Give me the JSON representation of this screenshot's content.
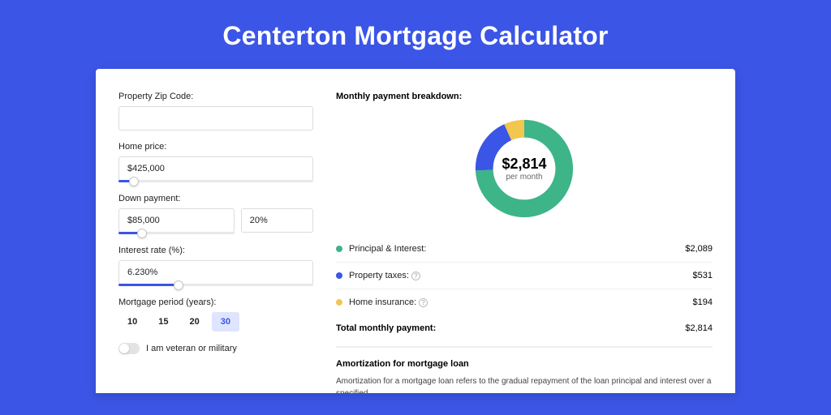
{
  "title": "Centerton Mortgage Calculator",
  "form": {
    "zip_label": "Property Zip Code:",
    "zip_value": "",
    "home_price_label": "Home price:",
    "home_price_value": "$425,000",
    "home_price_slider_pct": 8,
    "down_label": "Down payment:",
    "down_amount_value": "$85,000",
    "down_percent_value": "20%",
    "down_slider_pct": 20,
    "rate_label": "Interest rate (%):",
    "rate_value": "6.230%",
    "rate_slider_pct": 31,
    "period_label": "Mortgage period (years):",
    "periods": [
      "10",
      "15",
      "20",
      "30"
    ],
    "period_active_index": 3,
    "veteran_label": "I am veteran or military",
    "veteran_on": false
  },
  "breakdown": {
    "heading": "Monthly payment breakdown:",
    "donut_amount": "$2,814",
    "donut_sub": "per month",
    "items": [
      {
        "label": "Principal & Interest:",
        "value": "$2,089",
        "color": "#3eb489",
        "info": false
      },
      {
        "label": "Property taxes:",
        "value": "$531",
        "color": "#3b55e6",
        "info": true
      },
      {
        "label": "Home insurance:",
        "value": "$194",
        "color": "#f3c64e",
        "info": true
      }
    ],
    "total_label": "Total monthly payment:",
    "total_value": "$2,814"
  },
  "amort": {
    "heading": "Amortization for mortgage loan",
    "text": "Amortization for a mortgage loan refers to the gradual repayment of the loan principal and interest over a specified"
  },
  "chart_data": {
    "type": "pie",
    "title": "Monthly payment breakdown",
    "series": [
      {
        "name": "Principal & Interest",
        "value": 2089,
        "color": "#3eb489"
      },
      {
        "name": "Property taxes",
        "value": 531,
        "color": "#3b55e6"
      },
      {
        "name": "Home insurance",
        "value": 194,
        "color": "#f3c64e"
      }
    ],
    "total": 2814,
    "center_label": "$2,814 per month"
  }
}
